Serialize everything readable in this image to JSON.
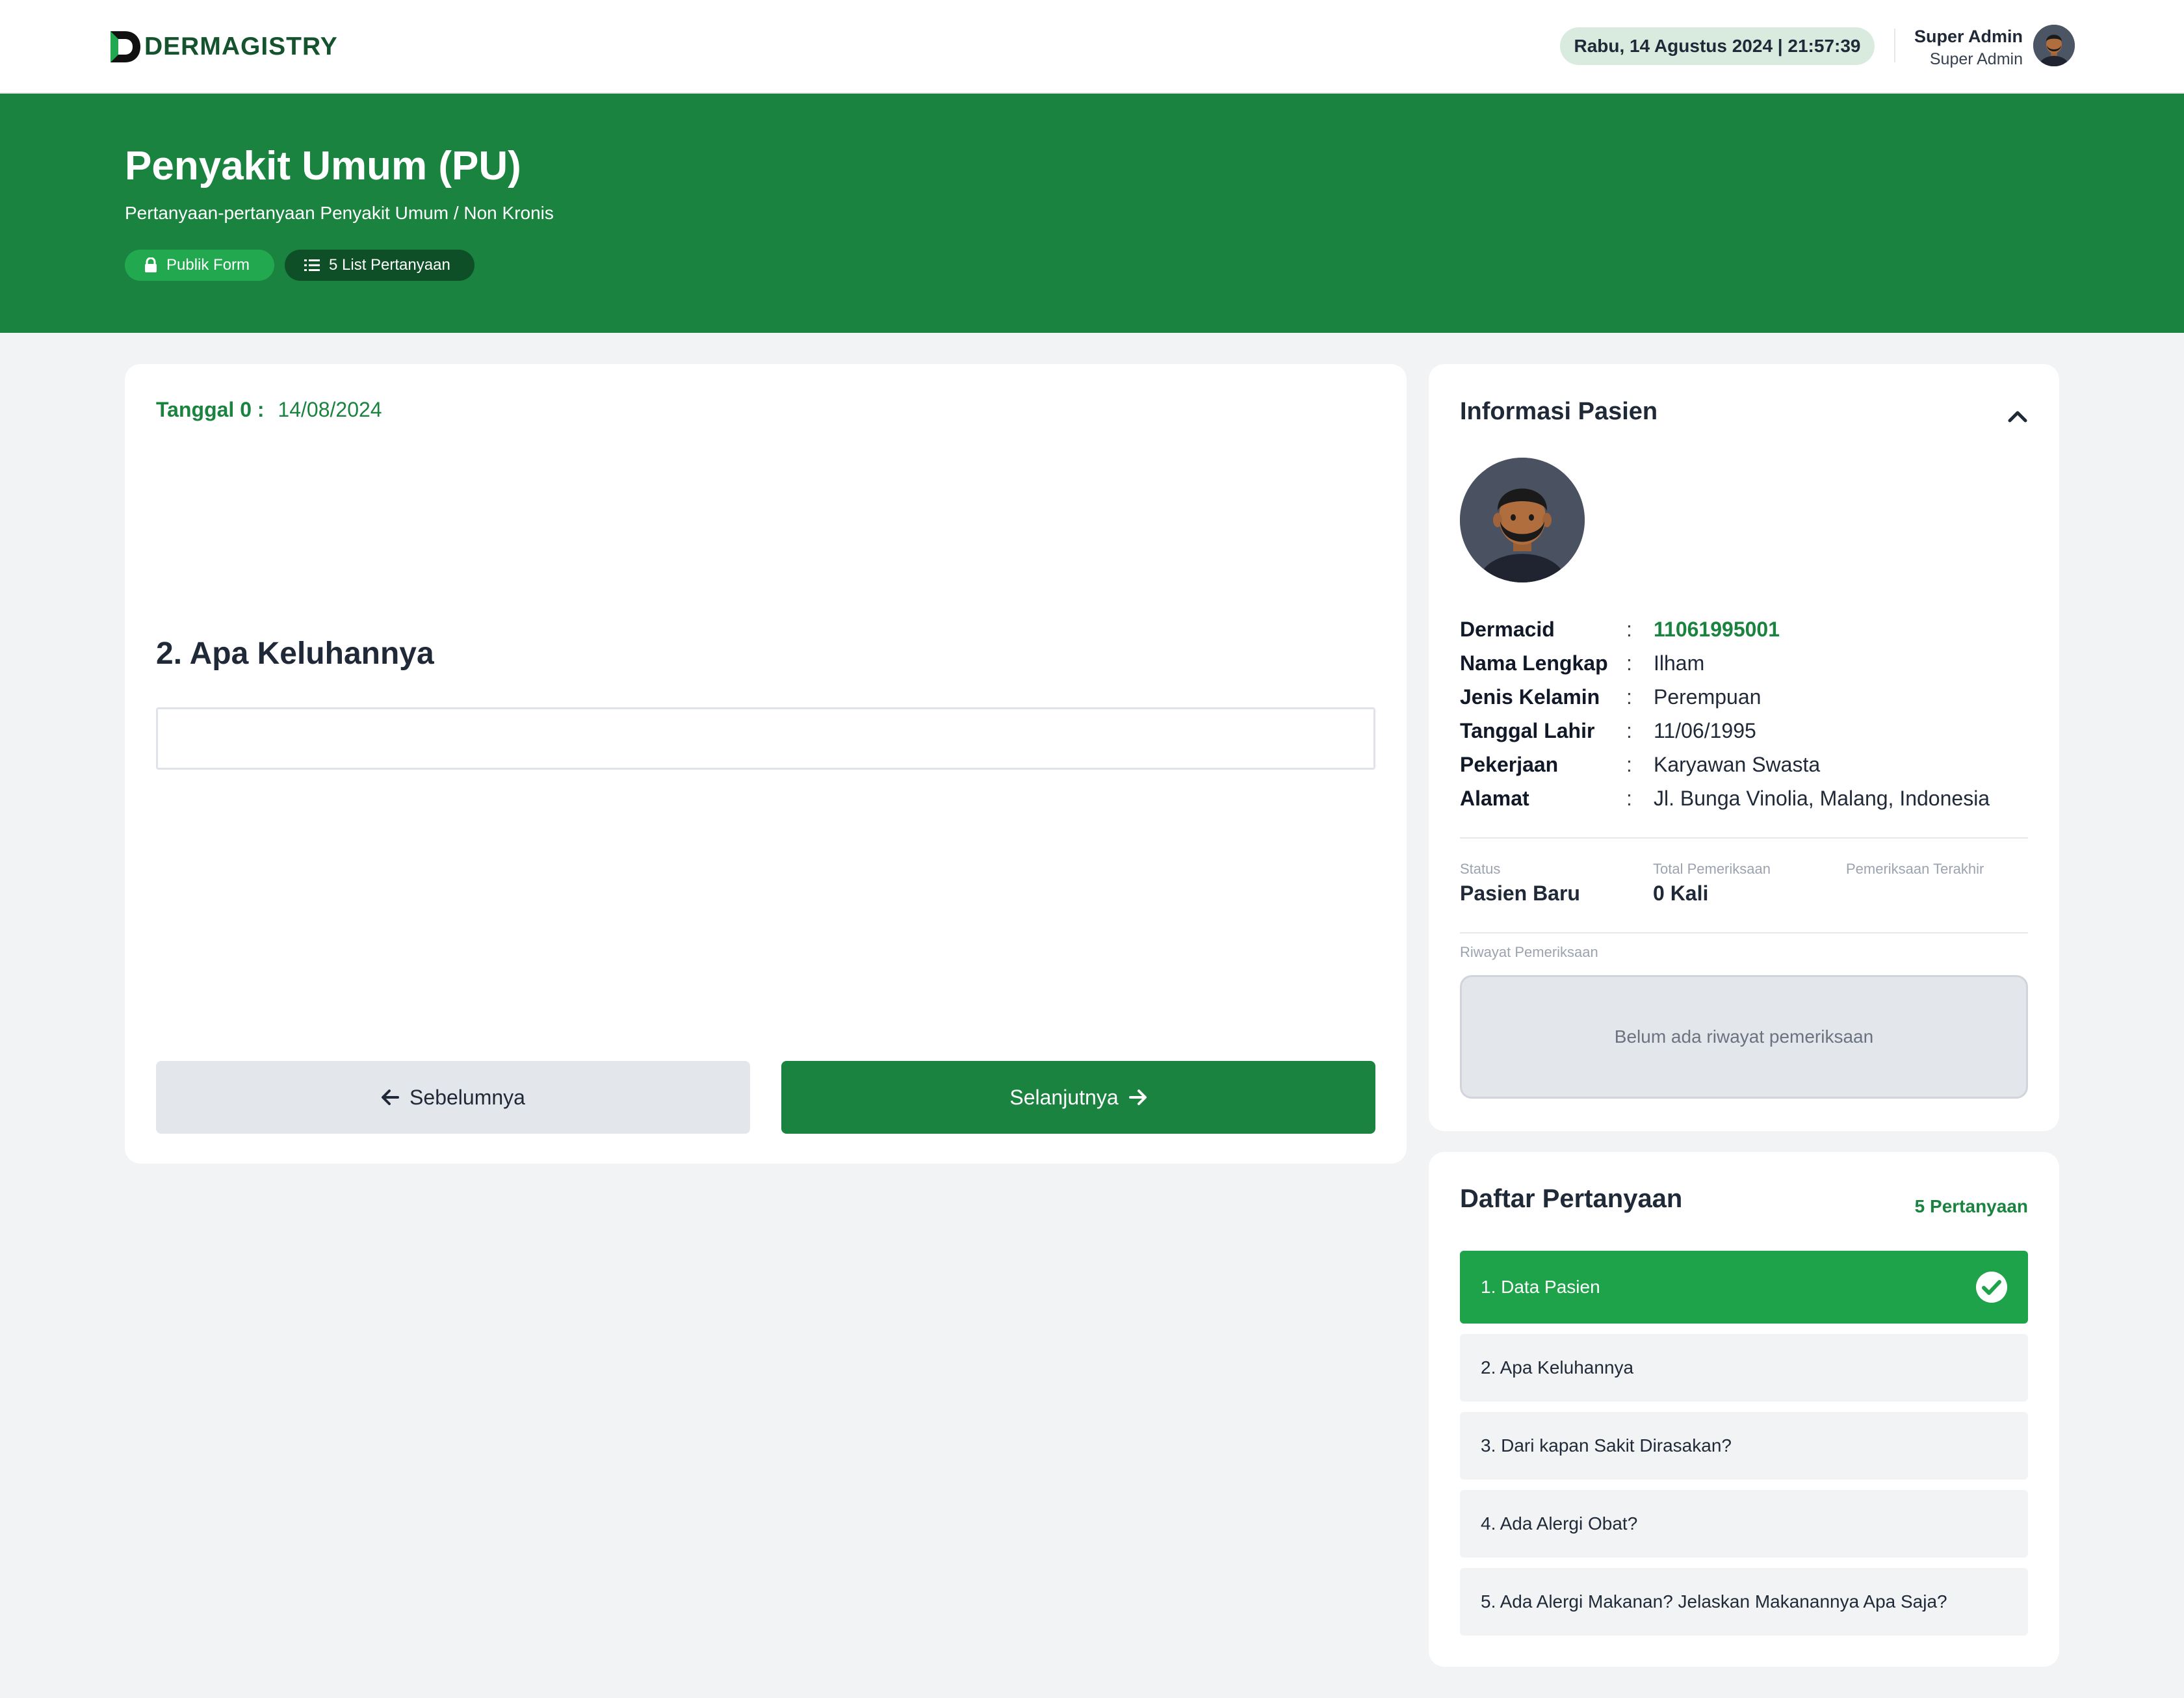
{
  "app": {
    "brand_initial": "D",
    "brand_name": "DERMAGISTRY",
    "datetime": "Rabu, 14 Agustus 2024 | 21:57:39",
    "user": {
      "name": "Super Admin",
      "role": "Super Admin"
    }
  },
  "hero": {
    "title": "Penyakit Umum (PU)",
    "subtitle": "Pertanyaan-pertanyaan Penyakit Umum / Non Kronis",
    "badges": [
      {
        "label": "Publik Form",
        "icon": "lock-icon"
      },
      {
        "label": "5 List Pertanyaan",
        "icon": "list-icon"
      }
    ]
  },
  "form": {
    "date_label": "Tanggal 0 :",
    "date_value": "14/08/2024",
    "question": "2. Apa Keluhannya",
    "answer_value": "",
    "prev_label": "Sebelumnya",
    "next_label": "Selanjutnya"
  },
  "patient": {
    "section_title": "Informasi Pasien",
    "fields": [
      {
        "key": "Dermacid",
        "value": "11061995001"
      },
      {
        "key": "Nama Lengkap",
        "value": "Ilham"
      },
      {
        "key": "Jenis Kelamin",
        "value": "Perempuan"
      },
      {
        "key": "Tanggal Lahir",
        "value": "11/06/1995"
      },
      {
        "key": "Pekerjaan",
        "value": "Karyawan Swasta"
      },
      {
        "key": "Alamat",
        "value": "Jl. Bunga Vinolia, Malang, Indonesia"
      }
    ],
    "separator": ":",
    "stats": [
      {
        "label": "Status",
        "value": "Pasien Baru"
      },
      {
        "label": "Total Pemeriksaan",
        "value": "0 Kali"
      },
      {
        "label": "Pemeriksaan Terakhir",
        "value": ""
      }
    ],
    "history_label": "Riwayat Pemeriksaan",
    "history_empty": "Belum ada riwayat pemeriksaan"
  },
  "questions": {
    "title": "Daftar Pertanyaan",
    "count_label": "5 Pertanyaan",
    "items": [
      {
        "label": "1. Data Pasien",
        "done": true
      },
      {
        "label": "2. Apa Keluhannya",
        "done": false
      },
      {
        "label": "3. Dari kapan Sakit Dirasakan?",
        "done": false
      },
      {
        "label": "4. Ada Alergi Obat?",
        "done": false
      },
      {
        "label": "5. Ada Alergi Makanan? Jelaskan Makanannya Apa Saja?",
        "done": false
      }
    ]
  },
  "colors": {
    "brand_green": "#1a833f",
    "active_green": "#1fa34a",
    "dark_green": "#14532d"
  }
}
